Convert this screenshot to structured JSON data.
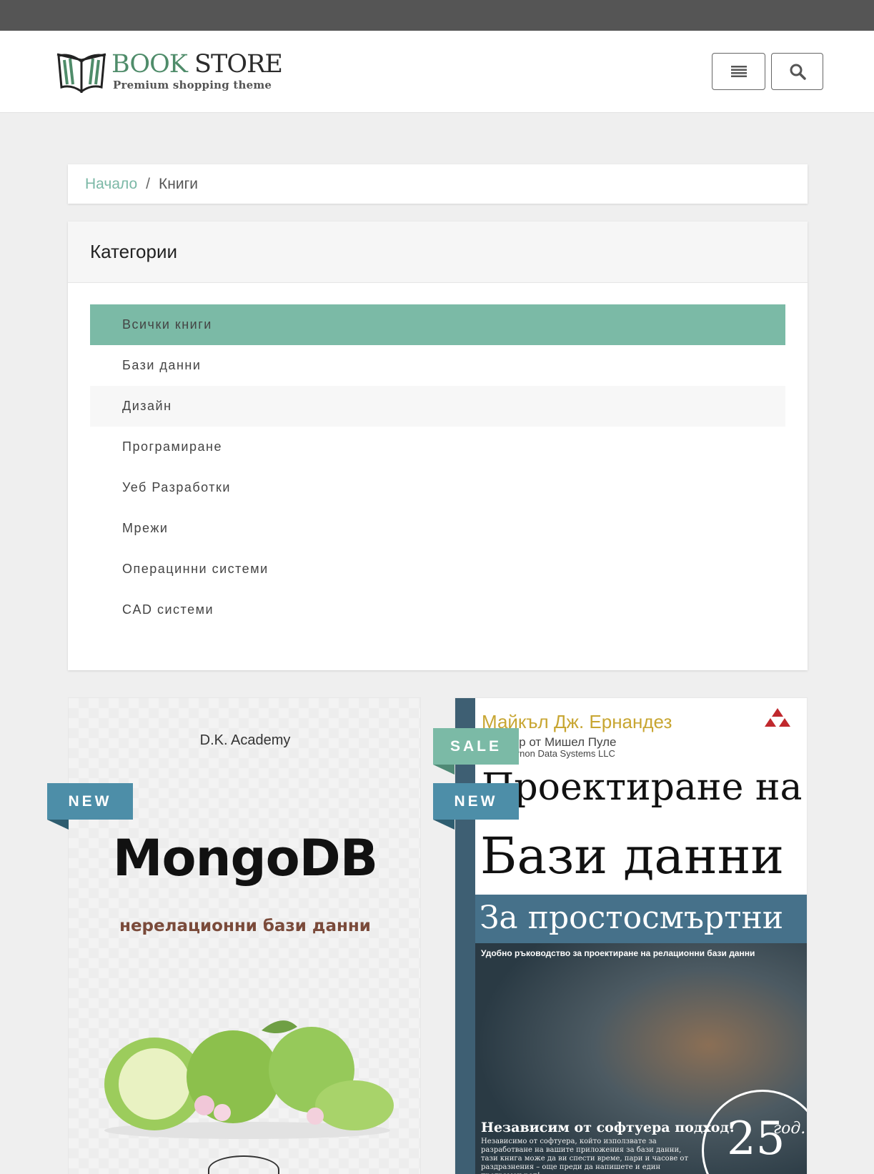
{
  "header": {
    "logo_book": "BOOK",
    "logo_store": "STORE",
    "logo_tagline": "Premium shopping theme",
    "menu_icon": "hamburger-icon",
    "search_icon": "search-icon"
  },
  "breadcrumb": {
    "home": "Начало",
    "separator": "/",
    "current": "Книги"
  },
  "categories": {
    "title": "Категории",
    "items": [
      {
        "label": "Всички книги"
      },
      {
        "label": "Бази данни"
      },
      {
        "label": "Дизайн"
      },
      {
        "label": "Програмиране"
      },
      {
        "label": "Уеб Разработки"
      },
      {
        "label": "Мрежи"
      },
      {
        "label": "Операцинни системи"
      },
      {
        "label": "CAD системи"
      }
    ]
  },
  "products": [
    {
      "badges": [
        "NEW"
      ],
      "cover": {
        "publisher": "D.K. Academy",
        "title": "MongoDB",
        "subtitle": "нерелационни бази данни"
      }
    },
    {
      "badges": [
        "SALE",
        "NEW"
      ],
      "cover": {
        "author": "Майкъл Дж. Ернандез",
        "coauthor": "Мишел Пуле",
        "coauthor_prefix": "...р от",
        "company": "...rnon Data Systems LLC",
        "line1": "Проектиране на",
        "line2": "Бази данни",
        "line3": "За простосмъртни",
        "tagline": "Удобно ръководство за проектиране на релационни бази данни",
        "independent": "Независим от софтуера подход!",
        "independent_body": "Независимо от софтуера, който използвате за разработване на вашите приложения за бази данни, тази книга може да ви спести време, пари и часове от раздразнения – още преди да напишете и един програмен ред!",
        "anniversary": "25",
        "anniversary_unit": "год."
      }
    }
  ],
  "colors": {
    "accent": "#7bbaa6",
    "new_badge": "#4d8ea8",
    "topbar": "#555555"
  }
}
